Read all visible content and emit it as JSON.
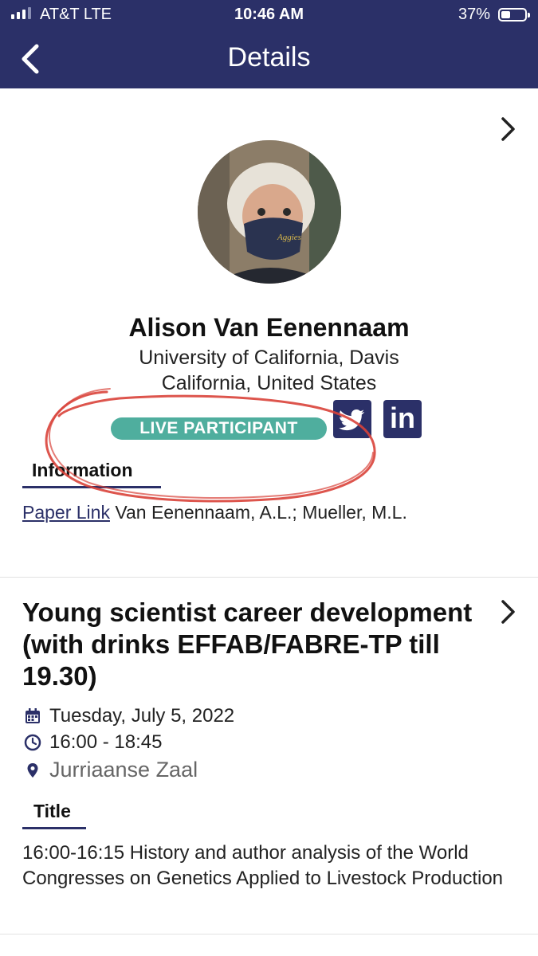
{
  "status_bar": {
    "carrier": "AT&T  LTE",
    "time": "10:46 AM",
    "battery": "37%",
    "battery_level": 0.37
  },
  "header": {
    "title": "Details",
    "back_icon": "chevron-left-icon"
  },
  "person": {
    "name": "Alison Van Eenennaam",
    "affiliation": "University of California, Davis",
    "location": "California, United States",
    "badge": "LIVE PARTICIPANT",
    "social": [
      "twitter-icon",
      "linkedin-icon"
    ],
    "linkedin_text": "in",
    "tab": "Information",
    "paper_link_label": "Paper Link",
    "paper_authors": "Van Eenennaam, A.L.; Mueller, M.L."
  },
  "session": {
    "title": "Young scientist career development (with drinks EFFAB/FABRE-TP till 19.30)",
    "date": "Tuesday, July 5, 2022",
    "time": "16:00 - 18:45",
    "location": "Jurriaanse Zaal",
    "tab": "Title",
    "description": "16:00-16:15 History and author analysis of the World Congresses on Genetics Applied to Livestock Production"
  },
  "colors": {
    "header_bg": "#2b3068",
    "badge_bg": "#4fae9e",
    "annotation": "#d9433a"
  }
}
